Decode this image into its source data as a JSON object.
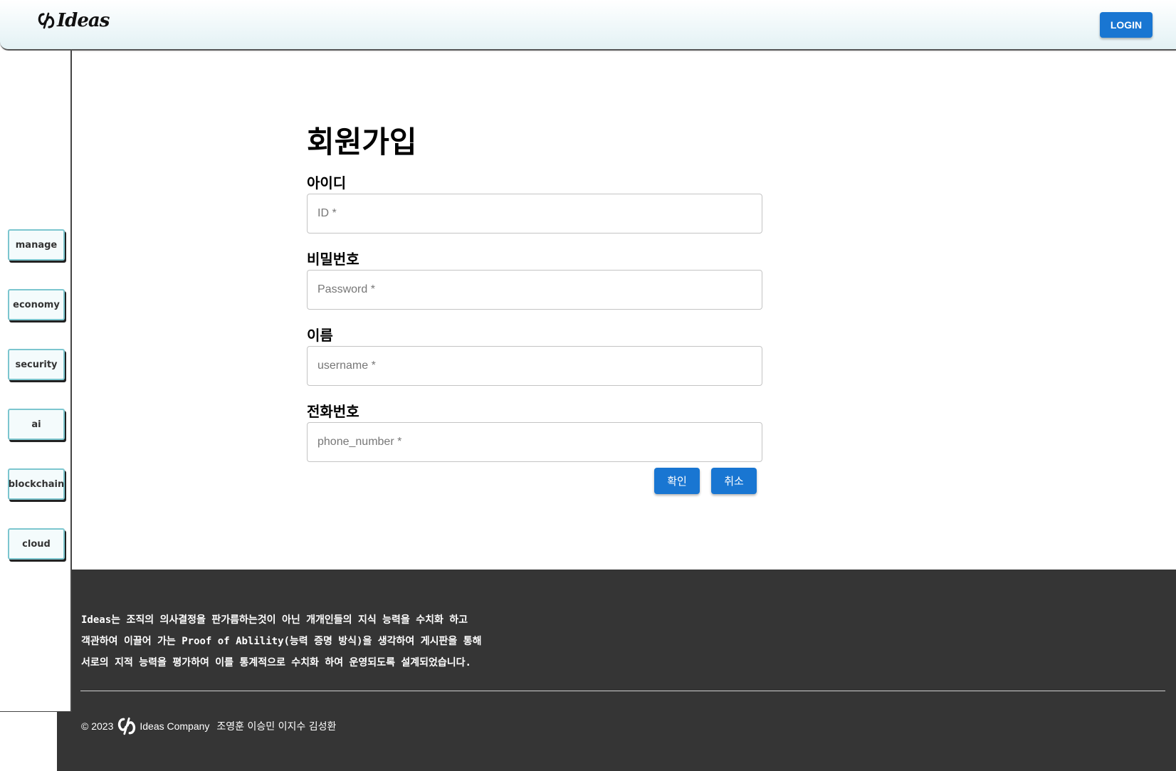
{
  "header": {
    "logo_text": "Ideas",
    "login_label": "LOGIN"
  },
  "sidebar": {
    "items": [
      {
        "label": "manage"
      },
      {
        "label": "economy"
      },
      {
        "label": "security"
      },
      {
        "label": "ai"
      },
      {
        "label": "blockchain"
      },
      {
        "label": "cloud"
      }
    ]
  },
  "form": {
    "title": "회원가입",
    "fields": [
      {
        "label": "아이디",
        "placeholder": "ID *",
        "value": ""
      },
      {
        "label": "비밀번호",
        "placeholder": "Password *",
        "value": ""
      },
      {
        "label": "이름",
        "placeholder": "username *",
        "value": ""
      },
      {
        "label": "전화번호",
        "placeholder": "phone_number *",
        "value": ""
      }
    ],
    "confirm_label": "확인",
    "cancel_label": "취소"
  },
  "footer": {
    "lines": [
      "Ideas는 조직의 의사결정을 판가름하는것이 아닌 개개인들의 지식 능력을 수치화 하고",
      "객관하여 이끌어 가는 Proof of Ablility(능력 증명 방식)을 생각하여 게시판을 통해",
      "서로의 지적 능력을 평가하여 이를 통계적으로 수치화 하여 운영되도록 설계되었습니다."
    ],
    "copyright": "© 2023",
    "company": "Ideas Company",
    "members": "조영훈 이승민 이지수 김성환"
  },
  "colors": {
    "primary": "#1976d2",
    "footer_bg": "#353535",
    "sidebar_border": "#7cc6cf"
  }
}
